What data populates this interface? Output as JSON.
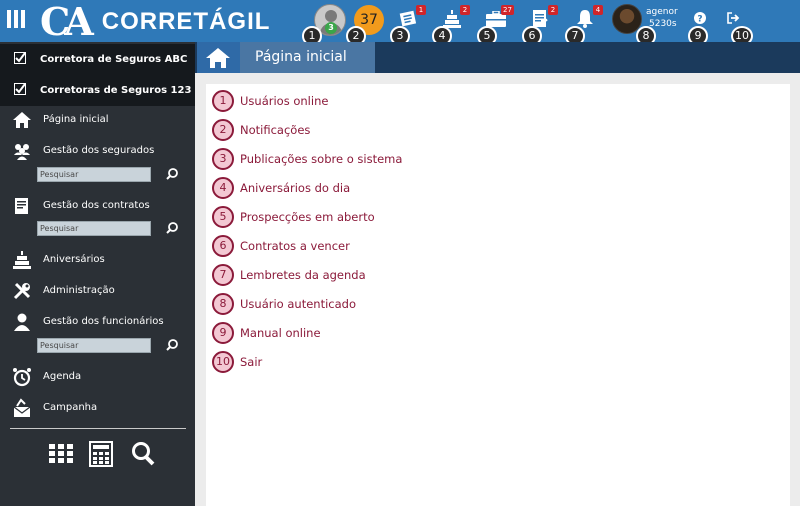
{
  "header": {
    "logo_mark": "CA",
    "logo_text": "CORRETÁGIL",
    "avatar_badge": "3",
    "orange_count": "37",
    "badges": {
      "news": "1",
      "birthdays": "2",
      "prospects": "27",
      "contracts": "2",
      "reminders": "4"
    },
    "user_line1": "agenor",
    "user_line2": "5230s",
    "numbers": [
      "1",
      "2",
      "3",
      "4",
      "5",
      "6",
      "7",
      "8",
      "9",
      "10"
    ]
  },
  "sidebar": {
    "companies": [
      "Corretora de Seguros ABC",
      "Corretoras de Seguros 123"
    ],
    "nav": {
      "home": "Página inicial",
      "insured": "Gestão dos segurados",
      "contracts": "Gestão dos contratos",
      "birthdays": "Aniversários",
      "admin": "Administração",
      "staff": "Gestão dos funcionários",
      "agenda": "Agenda",
      "campaign": "Campanha"
    },
    "search_placeholder": "Pesquisar"
  },
  "main": {
    "page_title": "Página inicial",
    "items": [
      {
        "n": "1",
        "label": "Usuários online"
      },
      {
        "n": "2",
        "label": "Notificações"
      },
      {
        "n": "3",
        "label": "Publicações sobre o sistema"
      },
      {
        "n": "4",
        "label": "Aniversários do dia"
      },
      {
        "n": "5",
        "label": "Prospecções em aberto"
      },
      {
        "n": "6",
        "label": "Contratos a vencer"
      },
      {
        "n": "7",
        "label": "Lembretes da agenda"
      },
      {
        "n": "8",
        "label": "Usuário autenticado"
      },
      {
        "n": "9",
        "label": "Manual online"
      },
      {
        "n": "10",
        "label": "Sair"
      }
    ]
  }
}
